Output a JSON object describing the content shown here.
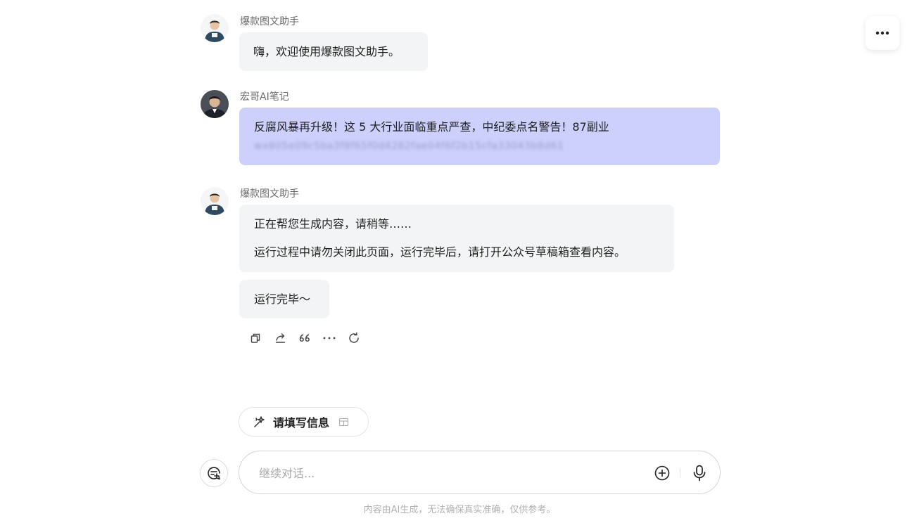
{
  "header": {
    "more_icon": "ellipsis-icon"
  },
  "messages": [
    {
      "role": "bot",
      "sender": "爆款图文助手",
      "lines": [
        "嗨，欢迎使用爆款图文助手。"
      ]
    },
    {
      "role": "user",
      "sender": "宏哥AI笔记",
      "lines": [
        "反腐风暴再升级！这 5 大行业面临重点严查，中纪委点名警告！87副业"
      ],
      "blurred": "wx805e09c5ba3f8f65f0d4282fae04f6f2b15cfa33043b8d61"
    },
    {
      "role": "bot",
      "sender": "爆款图文助手",
      "lines": [
        "正在帮您生成内容，请稍等……",
        "运行过程中请勿关闭此页面，运行完毕后，请打开公众号草稿箱查看内容。"
      ]
    },
    {
      "role": "bot",
      "lines": [
        "运行完毕～"
      ]
    }
  ],
  "actions": [
    "copy-icon",
    "share-icon",
    "quote-icon",
    "more-icon",
    "regenerate-icon"
  ],
  "fill_chip": {
    "label": "请填写信息"
  },
  "composer": {
    "placeholder": "继续对话..."
  },
  "disclaimer": "内容由AI生成，无法确保真实准确，仅供参考。"
}
